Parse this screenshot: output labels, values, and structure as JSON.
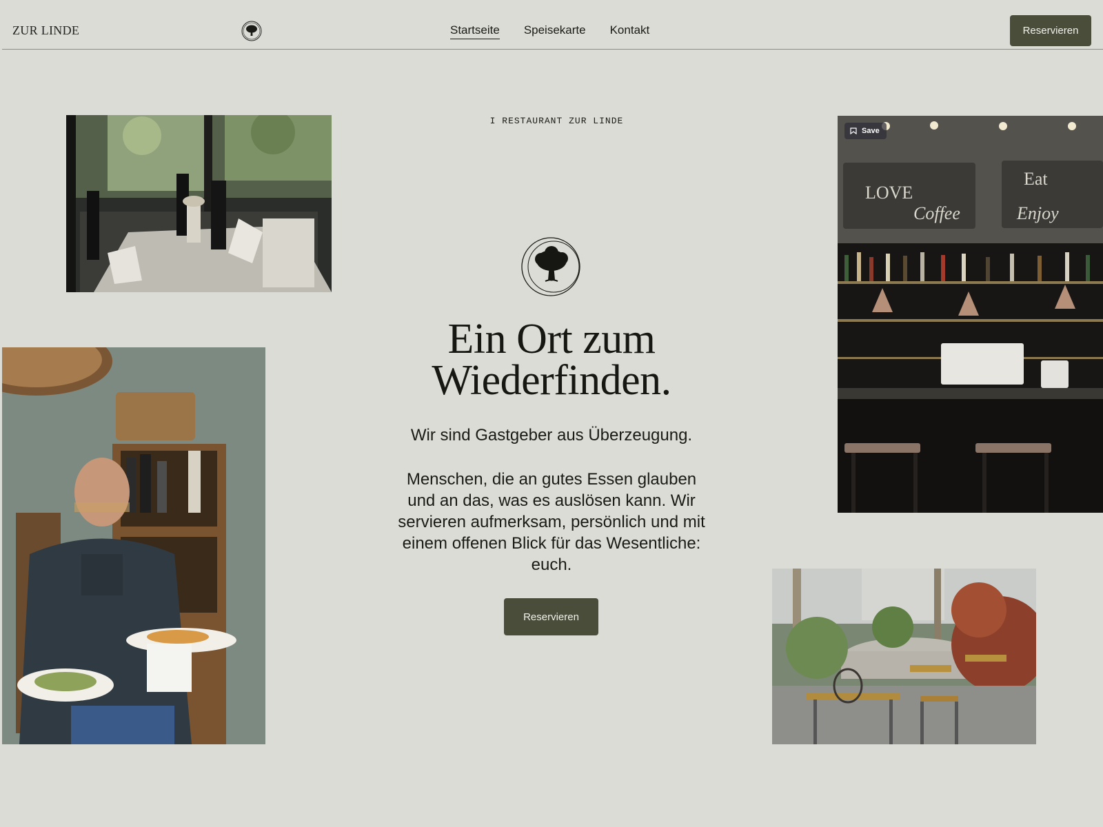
{
  "header": {
    "brand": "ZUR LINDE",
    "logo_icon": "linden-tree-logo-icon",
    "nav": [
      {
        "label": "Startseite",
        "active": true
      },
      {
        "label": "Speisekarte",
        "active": false
      },
      {
        "label": "Kontakt",
        "active": false
      }
    ],
    "reserve_label": "Reservieren"
  },
  "hero": {
    "eyebrow": "I RESTAURANT ZUR LINDE",
    "logo_icon": "linden-tree-emblem-icon",
    "headline": "Ein Ort zum Wiederfinden.",
    "tagline": "Wir sind Gastgeber aus Überzeugung.",
    "body": "Menschen, die an gutes Essen glauben und an das, was es auslösen kann. Wir servieren aufmerksam, persönlich und mit einem offenen Blick für das Wesentliche: euch.",
    "cta_label": "Reservieren"
  },
  "photos": {
    "dining_room": "photo-dining-room",
    "host": "photo-host-with-plates",
    "bar": "photo-bar",
    "terrace": "photo-terrace"
  },
  "save_chip": {
    "label": "Save",
    "icon": "bookmark-icon"
  },
  "colors": {
    "background": "#dcdcd6",
    "button": "#4a4d3a",
    "button_text": "#f2f2ec",
    "text": "#1a1a16"
  }
}
